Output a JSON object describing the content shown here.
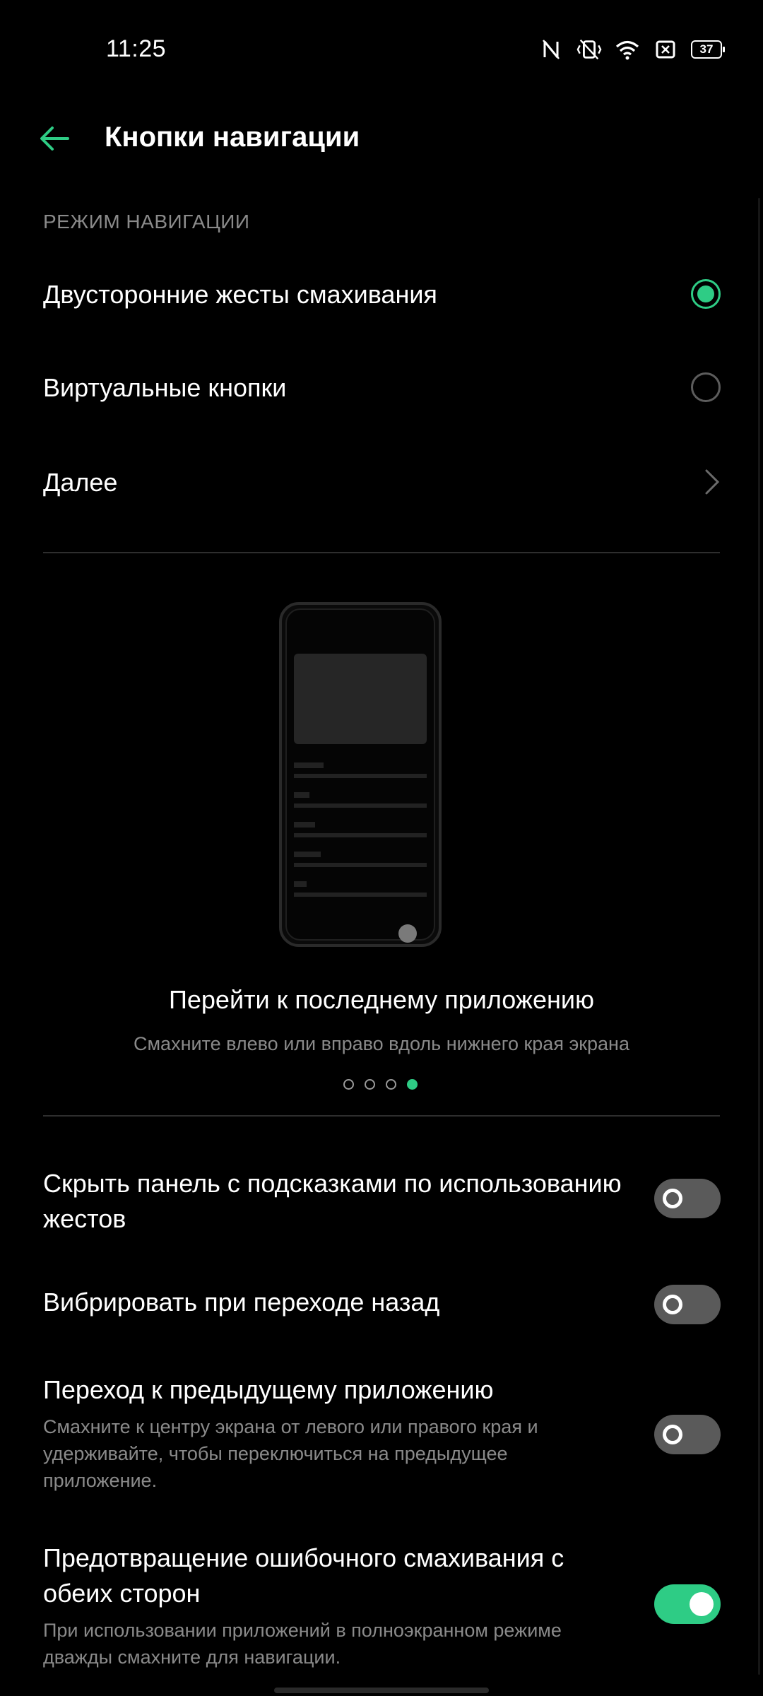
{
  "status_bar": {
    "time": "11:25",
    "battery": "37",
    "icons": [
      "nfc-icon",
      "vibrate-mute-icon",
      "wifi-icon",
      "sim-icon",
      "battery-icon"
    ]
  },
  "header": {
    "back_icon": "arrow-left-icon",
    "title": "Кнопки навигации"
  },
  "navigation_mode": {
    "section_label": "РЕЖИМ НАВИГАЦИИ",
    "options": [
      {
        "label": "Двусторонние жесты смахивания",
        "selected": true
      },
      {
        "label": "Виртуальные кнопки",
        "selected": false
      }
    ],
    "more_label": "Далее"
  },
  "tutorial": {
    "title": "Перейти к последнему приложению",
    "description": "Смахните влево или вправо вдоль нижнего края экрана",
    "page_count": 4,
    "active_page": 4
  },
  "settings": [
    {
      "title": "Скрыть панель с подсказками по использованию жестов",
      "description": "",
      "enabled": false
    },
    {
      "title": "Вибрировать при переходе назад",
      "description": "",
      "enabled": false
    },
    {
      "title": "Переход к предыдущему приложению",
      "description": "Смахните к центру экрана от левого или правого края и удерживайте, чтобы переключиться на предыдущее приложение.",
      "enabled": false
    },
    {
      "title": "Предотвращение ошибочного смахивания с обеих сторон",
      "description": "При использовании приложений в полноэкранном режиме дважды смахните для навигации.",
      "enabled": true
    }
  ],
  "colors": {
    "accent": "#2ecc85",
    "background": "#000000",
    "secondary_text": "#8a8a8a"
  }
}
